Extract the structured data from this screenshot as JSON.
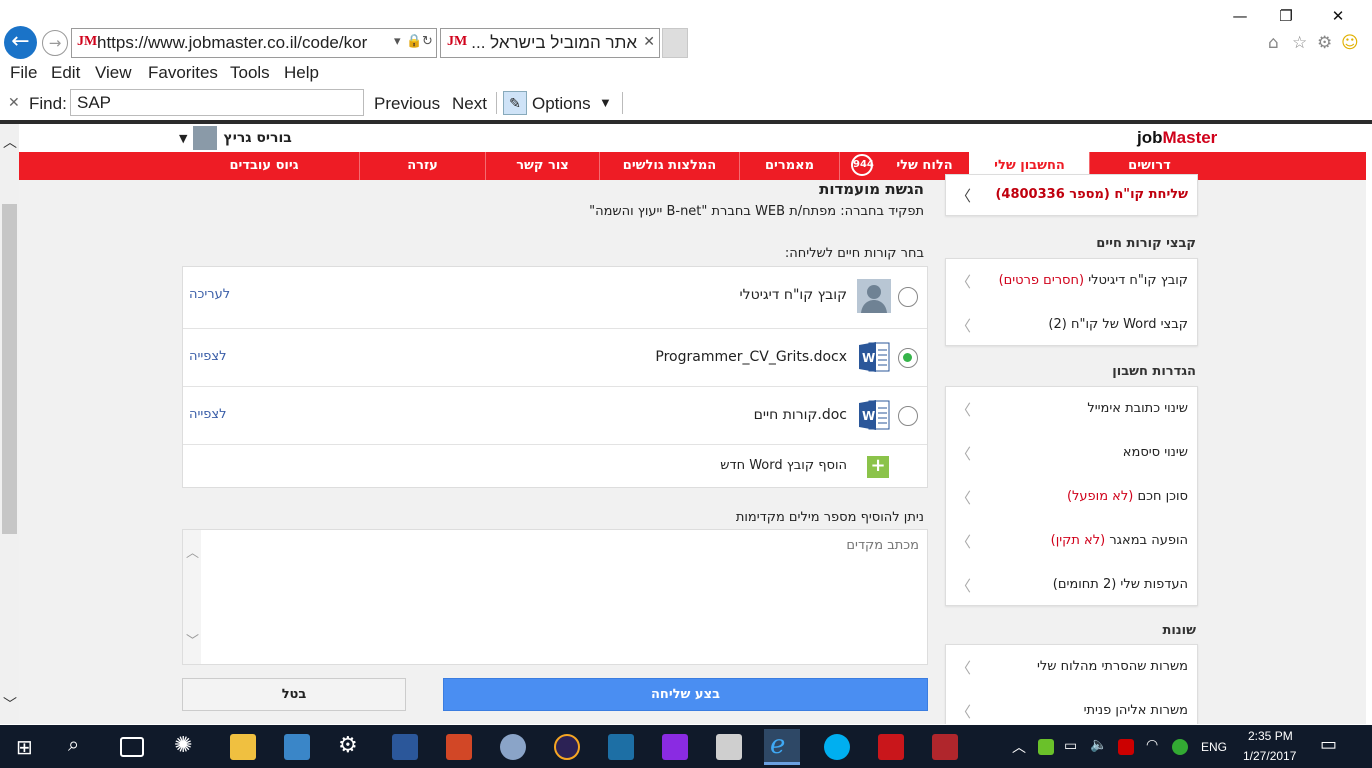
{
  "browser": {
    "window_controls": {
      "minimize": "—",
      "restore": "❐",
      "close": "✕"
    },
    "url": "https://www.jobmaster.co.il/code/kor",
    "tab_title": "אתר המוביל בישראל ...",
    "favicon": "JM",
    "menu": [
      "File",
      "Edit",
      "View",
      "Favorites",
      "Tools",
      "Help"
    ],
    "find": {
      "label": "Find:",
      "value": "SAP",
      "previous": "Previous",
      "next": "Next",
      "options": "Options"
    }
  },
  "site": {
    "logo_job": "job",
    "logo_master": "Master",
    "user_name": "בוריס גריץ",
    "nav": [
      {
        "label": "דרושים"
      },
      {
        "label": "החשבון שלי",
        "active": true
      },
      {
        "label": "הלוח שלי",
        "badge": "944"
      },
      {
        "label": "מאמרים"
      },
      {
        "label": "המלצות גולשים"
      },
      {
        "label": "צור קשר"
      },
      {
        "label": "עזרה"
      },
      {
        "label": "גיוס עובדים"
      }
    ]
  },
  "form": {
    "title": "הגשת מועמדות",
    "job_description": "תפקיד בחברה: מפתח/ת WEB בחברת \"B-net ייעוץ והשמה\"",
    "choose_label": "בחר קורות חיים לשליחה:",
    "cvs": [
      {
        "name": "קובץ קו\"ח דיגיטלי",
        "link": "לעריכה",
        "icon": "person-icon",
        "selected": false
      },
      {
        "name": "Programmer_CV_Grits.docx",
        "link": "לצפייה",
        "icon": "word-icon",
        "selected": true
      },
      {
        "name": "קורות חיים.doc",
        "link": "לצפייה",
        "icon": "word-icon",
        "selected": false
      }
    ],
    "add_word": "הוסף קובץ Word חדש",
    "intro_label": "ניתן להוסיף מספר מילים מקדימות",
    "cover_placeholder": "מכתב מקדים",
    "cancel": "בטל",
    "send": "בצע שליחה"
  },
  "sidebar": {
    "top_item": "שליחת קו\"ח (מספר 4800336)",
    "sections": [
      {
        "title": "קבצי קורות חיים",
        "items": [
          {
            "label": "קובץ קו\"ח דיגיטלי",
            "note": "(חסרים פרטים)"
          },
          {
            "label": "קבצי Word של קו\"ח (2)",
            "note": ""
          }
        ]
      },
      {
        "title": "הגדרות חשבון",
        "items": [
          {
            "label": "שינוי כתובת אימייל",
            "note": ""
          },
          {
            "label": "שינוי סיסמא",
            "note": ""
          },
          {
            "label": "סוכן חכם",
            "note": "(לא מופעל)"
          },
          {
            "label": "הופעה במאגר",
            "note": "(לא תקין)"
          },
          {
            "label": "העדפות שלי (2 תחומים)",
            "note": ""
          }
        ]
      },
      {
        "title": "שונות",
        "items": [
          {
            "label": "משרות שהסרתי מהלוח שלי",
            "note": ""
          },
          {
            "label": "משרות אליהן פניתי",
            "note": ""
          }
        ]
      }
    ]
  },
  "taskbar": {
    "language": "ENG",
    "time": "2:35 PM",
    "date": "1/27/2017"
  },
  "colors": {
    "brand_red": "#ee1c25",
    "send_blue": "#4a8ef2",
    "link_blue": "#3a5ea8"
  }
}
